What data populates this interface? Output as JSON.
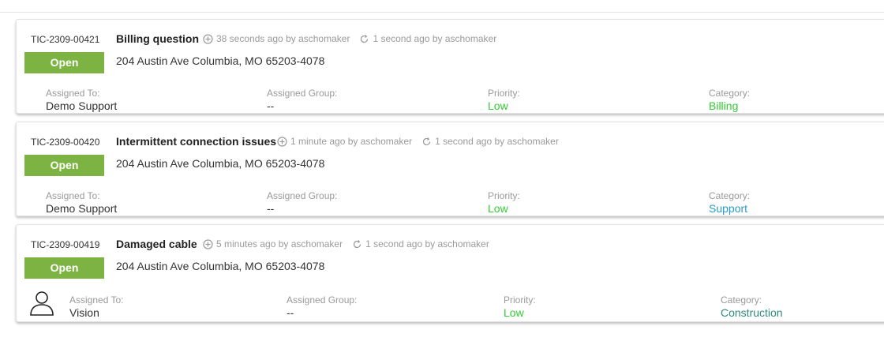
{
  "tickets": [
    {
      "id": "TIC-2309-00421",
      "title": "Billing question",
      "created": "38 seconds ago by aschomaker",
      "updated": "1 second ago by aschomaker",
      "status": "Open",
      "address": "204 Austin Ave Columbia, MO 65203-4078",
      "assigned_to_label": "Assigned To:",
      "assigned_to": "Demo Support",
      "assigned_group_label": "Assigned Group:",
      "assigned_group": "--",
      "priority_label": "Priority:",
      "priority": "Low",
      "category_label": "Category:",
      "category": "Billing"
    },
    {
      "id": "TIC-2309-00420",
      "title": "Intermittent connection issues",
      "created": "1 minute ago by aschomaker",
      "updated": "1 second ago by aschomaker",
      "status": "Open",
      "address": "204 Austin Ave Columbia, MO 65203-4078",
      "assigned_to_label": "Assigned To:",
      "assigned_to": "Demo Support",
      "assigned_group_label": "Assigned Group:",
      "assigned_group": "--",
      "priority_label": "Priority:",
      "priority": "Low",
      "category_label": "Category:",
      "category": "Support"
    },
    {
      "id": "TIC-2309-00419",
      "title": "Damaged cable",
      "created": "5 minutes ago by aschomaker",
      "updated": "1 second ago by aschomaker",
      "status": "Open",
      "address": "204 Austin Ave Columbia, MO 65203-4078",
      "assigned_to_label": "Assigned To:",
      "assigned_to": "Vision",
      "assigned_group_label": "Assigned Group:",
      "assigned_group": "--",
      "priority_label": "Priority:",
      "priority": "Low",
      "category_label": "Category:",
      "category": "Construction"
    }
  ],
  "colors": {
    "status_open": "#7cb342",
    "priority_low": "#33cc33",
    "category_billing": "#33cc33",
    "category_support": "#2a9ac9",
    "category_construction": "#2e8b7a"
  },
  "icons": {
    "created": "plus-circle-icon",
    "updated": "refresh-icon",
    "avatar": "user-icon"
  }
}
